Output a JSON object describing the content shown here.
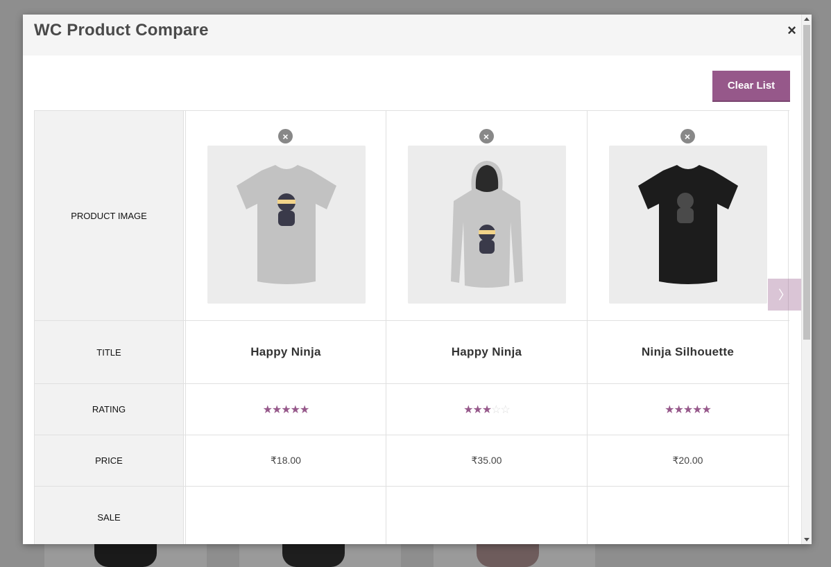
{
  "modal": {
    "title": "WC Product Compare",
    "close_label": "×",
    "clear_label": "Clear List",
    "next_label": "〉"
  },
  "rows": {
    "image_label": "Product Image",
    "title_label": "Title",
    "rating_label": "Rating",
    "price_label": "Price",
    "sale_label": "Sale"
  },
  "products": [
    {
      "title": "Happy Ninja",
      "price": "₹18.00",
      "rating": 5,
      "remove_label": "×",
      "image": "grey-tshirt-ninja"
    },
    {
      "title": "Happy Ninja",
      "price": "₹35.00",
      "rating": 3,
      "remove_label": "×",
      "image": "grey-hoodie-ninja"
    },
    {
      "title": "Ninja Silhouette",
      "price": "₹20.00",
      "rating": 5,
      "remove_label": "×",
      "image": "black-tshirt-silhouette"
    }
  ],
  "colors": {
    "accent": "#96588a",
    "header_bg": "#f5f5f5",
    "label_bg": "#f2f2f2"
  }
}
